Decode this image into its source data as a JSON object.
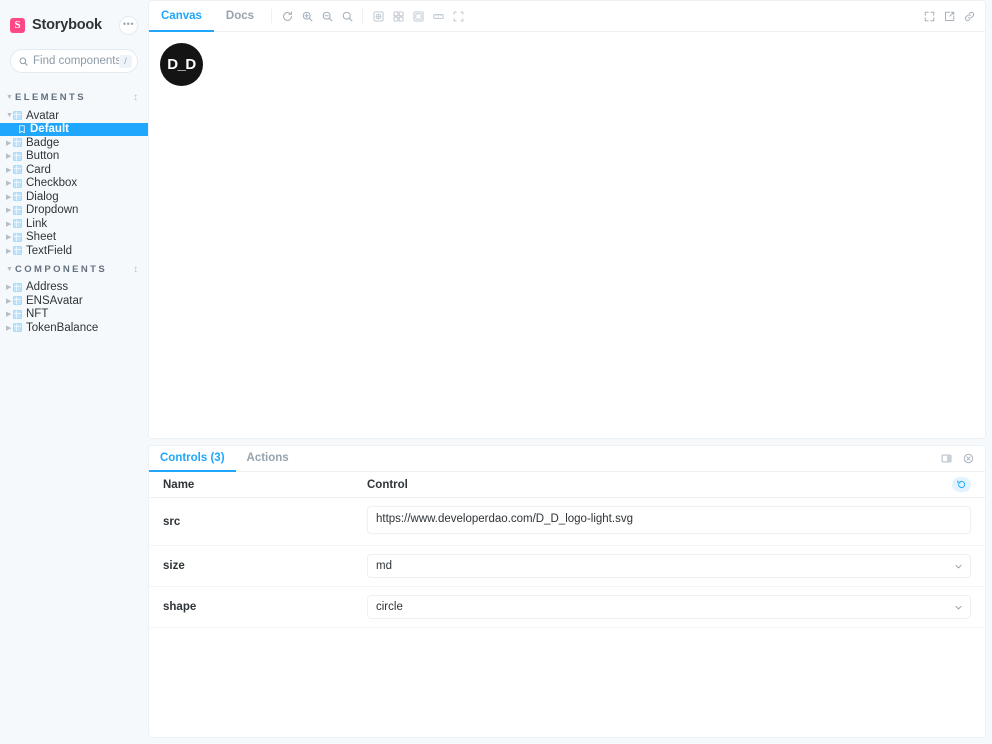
{
  "sidebar": {
    "brand": "Storybook",
    "brand_mark": "S",
    "brand_color": "#FF4785",
    "menu_button_label": "•••",
    "search": {
      "placeholder": "Find components",
      "value": "",
      "shortcut": "/",
      "icon": "search-icon"
    },
    "sections": [
      {
        "label": "ELEMENTS",
        "expanded": true,
        "items": [
          {
            "label": "Avatar",
            "icon": "component-icon",
            "expanded": true,
            "stories": [
              {
                "label": "Default",
                "icon": "story-icon",
                "selected": true
              }
            ]
          },
          {
            "label": "Badge",
            "icon": "component-icon",
            "expanded": false,
            "stories": []
          },
          {
            "label": "Button",
            "icon": "component-icon",
            "expanded": false,
            "stories": []
          },
          {
            "label": "Card",
            "icon": "component-icon",
            "expanded": false,
            "stories": []
          },
          {
            "label": "Checkbox",
            "icon": "component-icon",
            "expanded": false,
            "stories": []
          },
          {
            "label": "Dialog",
            "icon": "component-icon",
            "expanded": false,
            "stories": []
          },
          {
            "label": "Dropdown",
            "icon": "component-icon",
            "expanded": false,
            "stories": []
          },
          {
            "label": "Link",
            "icon": "component-icon",
            "expanded": false,
            "stories": []
          },
          {
            "label": "Sheet",
            "icon": "component-icon",
            "expanded": false,
            "stories": []
          },
          {
            "label": "TextField",
            "icon": "component-icon",
            "expanded": false,
            "stories": []
          }
        ]
      },
      {
        "label": "COMPONENTS",
        "expanded": true,
        "items": [
          {
            "label": "Address",
            "icon": "component-icon",
            "expanded": false,
            "stories": []
          },
          {
            "label": "ENSAvatar",
            "icon": "component-icon",
            "expanded": false,
            "stories": []
          },
          {
            "label": "NFT",
            "icon": "component-icon",
            "expanded": false,
            "stories": []
          },
          {
            "label": "TokenBalance",
            "icon": "component-icon",
            "expanded": false,
            "stories": []
          }
        ]
      }
    ],
    "selection_color": "#1EA7FD"
  },
  "toolbar": {
    "tabs": [
      {
        "label": "Canvas",
        "active": true
      },
      {
        "label": "Docs",
        "active": false
      }
    ],
    "tools": [
      {
        "name": "remount-icon"
      },
      {
        "name": "zoom-in-icon"
      },
      {
        "name": "zoom-out-icon"
      },
      {
        "name": "zoom-reset-icon"
      }
    ],
    "addons": [
      {
        "name": "backgrounds-icon"
      },
      {
        "name": "grid-icon"
      },
      {
        "name": "viewport-icon"
      },
      {
        "name": "measure-icon"
      },
      {
        "name": "outline-icon"
      }
    ],
    "right_tools": [
      {
        "name": "fullscreen-icon"
      },
      {
        "name": "open-in-new-tab-icon"
      },
      {
        "name": "copy-link-icon"
      }
    ],
    "accent_color": "#1EA7FD"
  },
  "canvas": {
    "avatar": {
      "text": "D_D",
      "shape": "circle",
      "background": "#141414",
      "foreground": "#FFFFFF"
    }
  },
  "panel": {
    "tabs": [
      {
        "label": "Controls (3)",
        "active": true
      },
      {
        "label": "Actions",
        "active": false
      }
    ],
    "right_tools": [
      {
        "name": "panel-position-icon"
      },
      {
        "name": "close-panel-icon"
      }
    ],
    "columns": {
      "name": "Name",
      "control": "Control"
    },
    "reset_button": {
      "name": "reset-controls-icon",
      "color": "#1EA7FD"
    },
    "controls": [
      {
        "name": "src",
        "type": "textarea",
        "value": "https://www.developerdao.com/D_D_logo-light.svg"
      },
      {
        "name": "size",
        "type": "select",
        "value": "md"
      },
      {
        "name": "shape",
        "type": "select",
        "value": "circle"
      }
    ]
  }
}
